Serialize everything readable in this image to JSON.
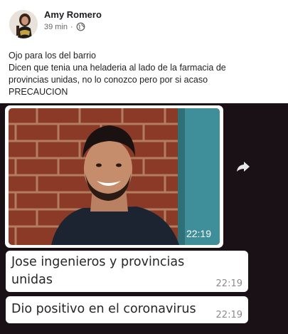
{
  "post": {
    "author": "Amy Romero",
    "time": "39 min",
    "separator": "·",
    "privacy_icon": "globe-icon",
    "lines": [
      "Ojo para los del barrio",
      "Dicen que tenia una heladeria al lado de la farmacia de",
      "provincias unidas, no lo conozco pero por si acaso",
      "PRECAUCION"
    ]
  },
  "chat": {
    "photo_time": "22:19",
    "forward_icon": "forward-arrow-icon",
    "messages": [
      {
        "text": "Jose ingenieros y provincias unidas",
        "time": "22:19"
      },
      {
        "text": "Dio positivo en el coronavirus",
        "time": "22:19"
      }
    ]
  },
  "colors": {
    "chat_background": "#1a1117",
    "bubble": "#ffffff",
    "meta_text": "#65676b"
  }
}
